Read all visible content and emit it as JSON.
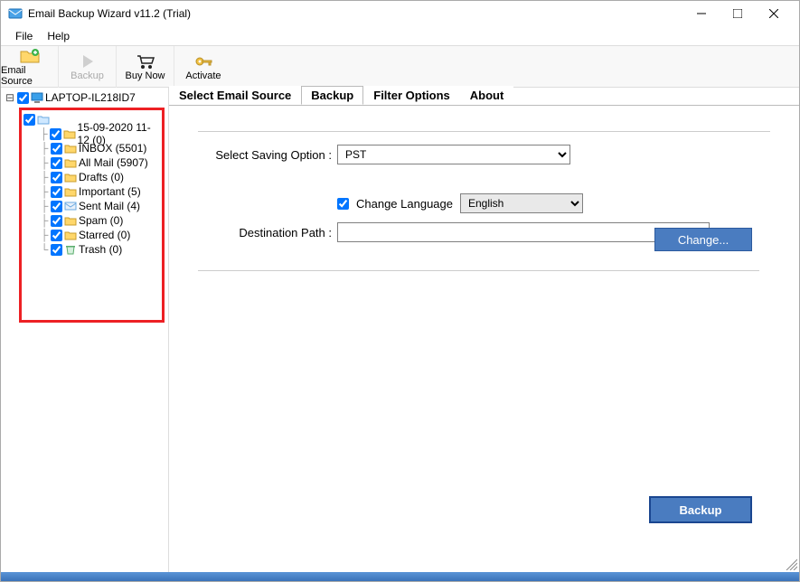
{
  "window": {
    "title": "Email Backup Wizard v11.2 (Trial)"
  },
  "menu": {
    "file": "File",
    "help": "Help"
  },
  "toolbar": {
    "email_source": "Email Source",
    "backup": "Backup",
    "buy_now": "Buy Now",
    "activate": "Activate"
  },
  "tree": {
    "root": "LAPTOP-IL218ID7",
    "folders": [
      {
        "label": "15-09-2020 11-12 (0)"
      },
      {
        "label": "INBOX (5501)"
      },
      {
        "label": "All Mail (5907)"
      },
      {
        "label": "Drafts (0)"
      },
      {
        "label": "Important (5)"
      },
      {
        "label": "Sent Mail (4)"
      },
      {
        "label": "Spam (0)"
      },
      {
        "label": "Starred (0)"
      },
      {
        "label": "Trash (0)"
      }
    ]
  },
  "tabs": {
    "select_email_source": "Select Email Source",
    "backup": "Backup",
    "filter_options": "Filter Options",
    "about": "About"
  },
  "form": {
    "saving_label": "Select Saving Option  :",
    "saving_value": "PST",
    "change_language_label": "Change Language",
    "language_value": "English",
    "destination_label": "Destination Path  :",
    "destination_value": "",
    "change_button": "Change...",
    "backup_button": "Backup"
  }
}
